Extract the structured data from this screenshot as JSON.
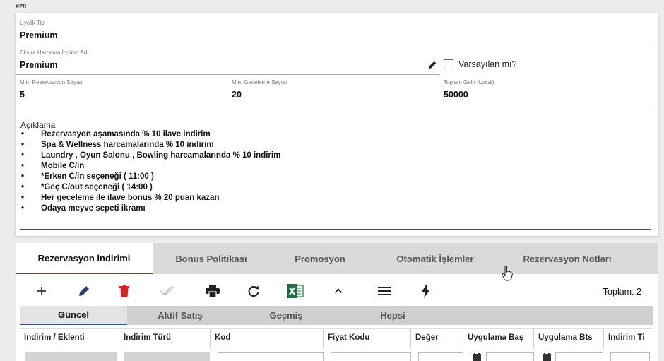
{
  "record_id": "#28",
  "form": {
    "membership_type": {
      "label": "Üyelik Tipi",
      "value": "Premium"
    },
    "extra_discount_name": {
      "label": "Ekstra Harcama İndirim Adı",
      "value": "Premium"
    },
    "is_default": {
      "label": "Varsayılan mı?",
      "checked": false
    },
    "min_reservations": {
      "label": "Min. Rezervasyon Sayısı",
      "value": "5"
    },
    "min_nights": {
      "label": "Min. Geceleme Sayısı",
      "value": "20"
    },
    "total_income": {
      "label": "Toplam Gelir (Local)",
      "value": "50000"
    },
    "description": {
      "label": "Açıklama",
      "items": [
        "Rezervasyon aşamasında % 10 ilave indirim",
        "Spa & Wellness harcamalarında % 10 indirim",
        "Laundry , Oyun Salonu , Bowling harcamalarında % 10 indirim",
        "Mobile C/in",
        "*Erken C/in seçeneği ( 11:00 )",
        "*Geç C/out seçeneği ( 14:00 )",
        " Her geceleme ile ilave bonus % 20 puan    kazan",
        "Odaya meyve sepeti ikramı"
      ]
    }
  },
  "tabs": [
    {
      "label": "Rezervasyon İndirimi",
      "active": true
    },
    {
      "label": "Bonus Politikası",
      "active": false
    },
    {
      "label": "Promosyon",
      "active": false
    },
    {
      "label": "Otomatik İşlemler",
      "active": false
    },
    {
      "label": "Rezervasyon Notları",
      "active": false
    }
  ],
  "toolbar": {
    "icons": [
      "add-icon",
      "edit-icon",
      "delete-icon",
      "approve-icon",
      "print-icon",
      "refresh-icon",
      "excel-icon",
      "collapse-icon",
      "menu-icon",
      "flash-icon"
    ],
    "total_label": "Toplam: 2"
  },
  "subtabs": [
    {
      "label": "Güncel",
      "active": true
    },
    {
      "label": "Aktif Satış",
      "active": false
    },
    {
      "label": "Geçmiş",
      "active": false
    },
    {
      "label": "Hepsi",
      "active": false
    }
  ],
  "grid": {
    "columns": [
      "İndirim / Eklenti",
      "İndirim Türü",
      "Kod",
      "Fiyat Kodu",
      "Değer",
      "Uygulama Baş",
      "Uygulama Bts",
      "İndirim Ti"
    ]
  },
  "colors": {
    "accent": "#3b4f7a",
    "delete": "#e02020",
    "excel": "#1f6f43",
    "tab_bar": "#d9d9d9"
  }
}
